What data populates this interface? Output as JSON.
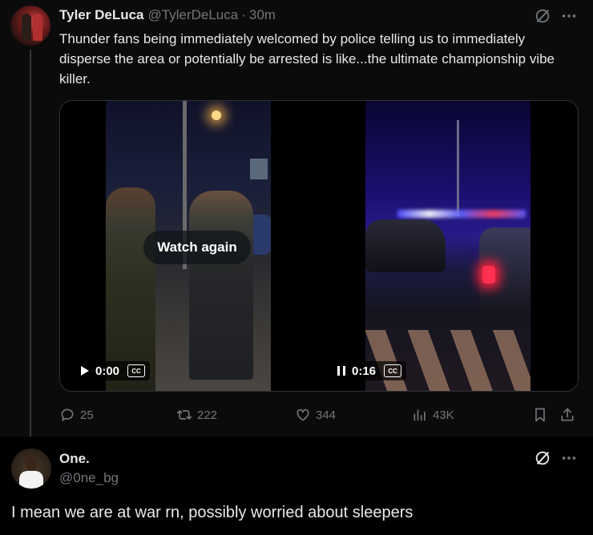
{
  "tweet1": {
    "author_name": "Tyler DeLuca",
    "author_handle": "@TylerDeLuca",
    "separator": "·",
    "time": "30m",
    "text": "Thunder fans being immediately welcomed by police telling us to immediately disperse the area or potentially be arrested is like...the ultimate championship vibe killer.",
    "videos": [
      {
        "overlay_label": "Watch again",
        "time": "0:00",
        "state": "play",
        "cc_label": "CC"
      },
      {
        "time": "0:16",
        "state": "pause",
        "cc_label": "CC"
      }
    ],
    "actions": {
      "replies": "25",
      "reposts": "222",
      "likes": "344",
      "views": "43K"
    },
    "icons": [
      "grok-icon",
      "more-icon",
      "reply-icon",
      "repost-icon",
      "like-icon",
      "views-icon",
      "bookmark-icon",
      "share-icon"
    ]
  },
  "tweet2": {
    "author_name": "One.",
    "author_handle": "@0ne_bg",
    "text": "I mean we are at war rn, possibly worried about sleepers"
  },
  "colors": {
    "background": "#000000",
    "text_primary": "#e7e9ea",
    "text_secondary": "#71767b",
    "border": "#2f3336"
  }
}
